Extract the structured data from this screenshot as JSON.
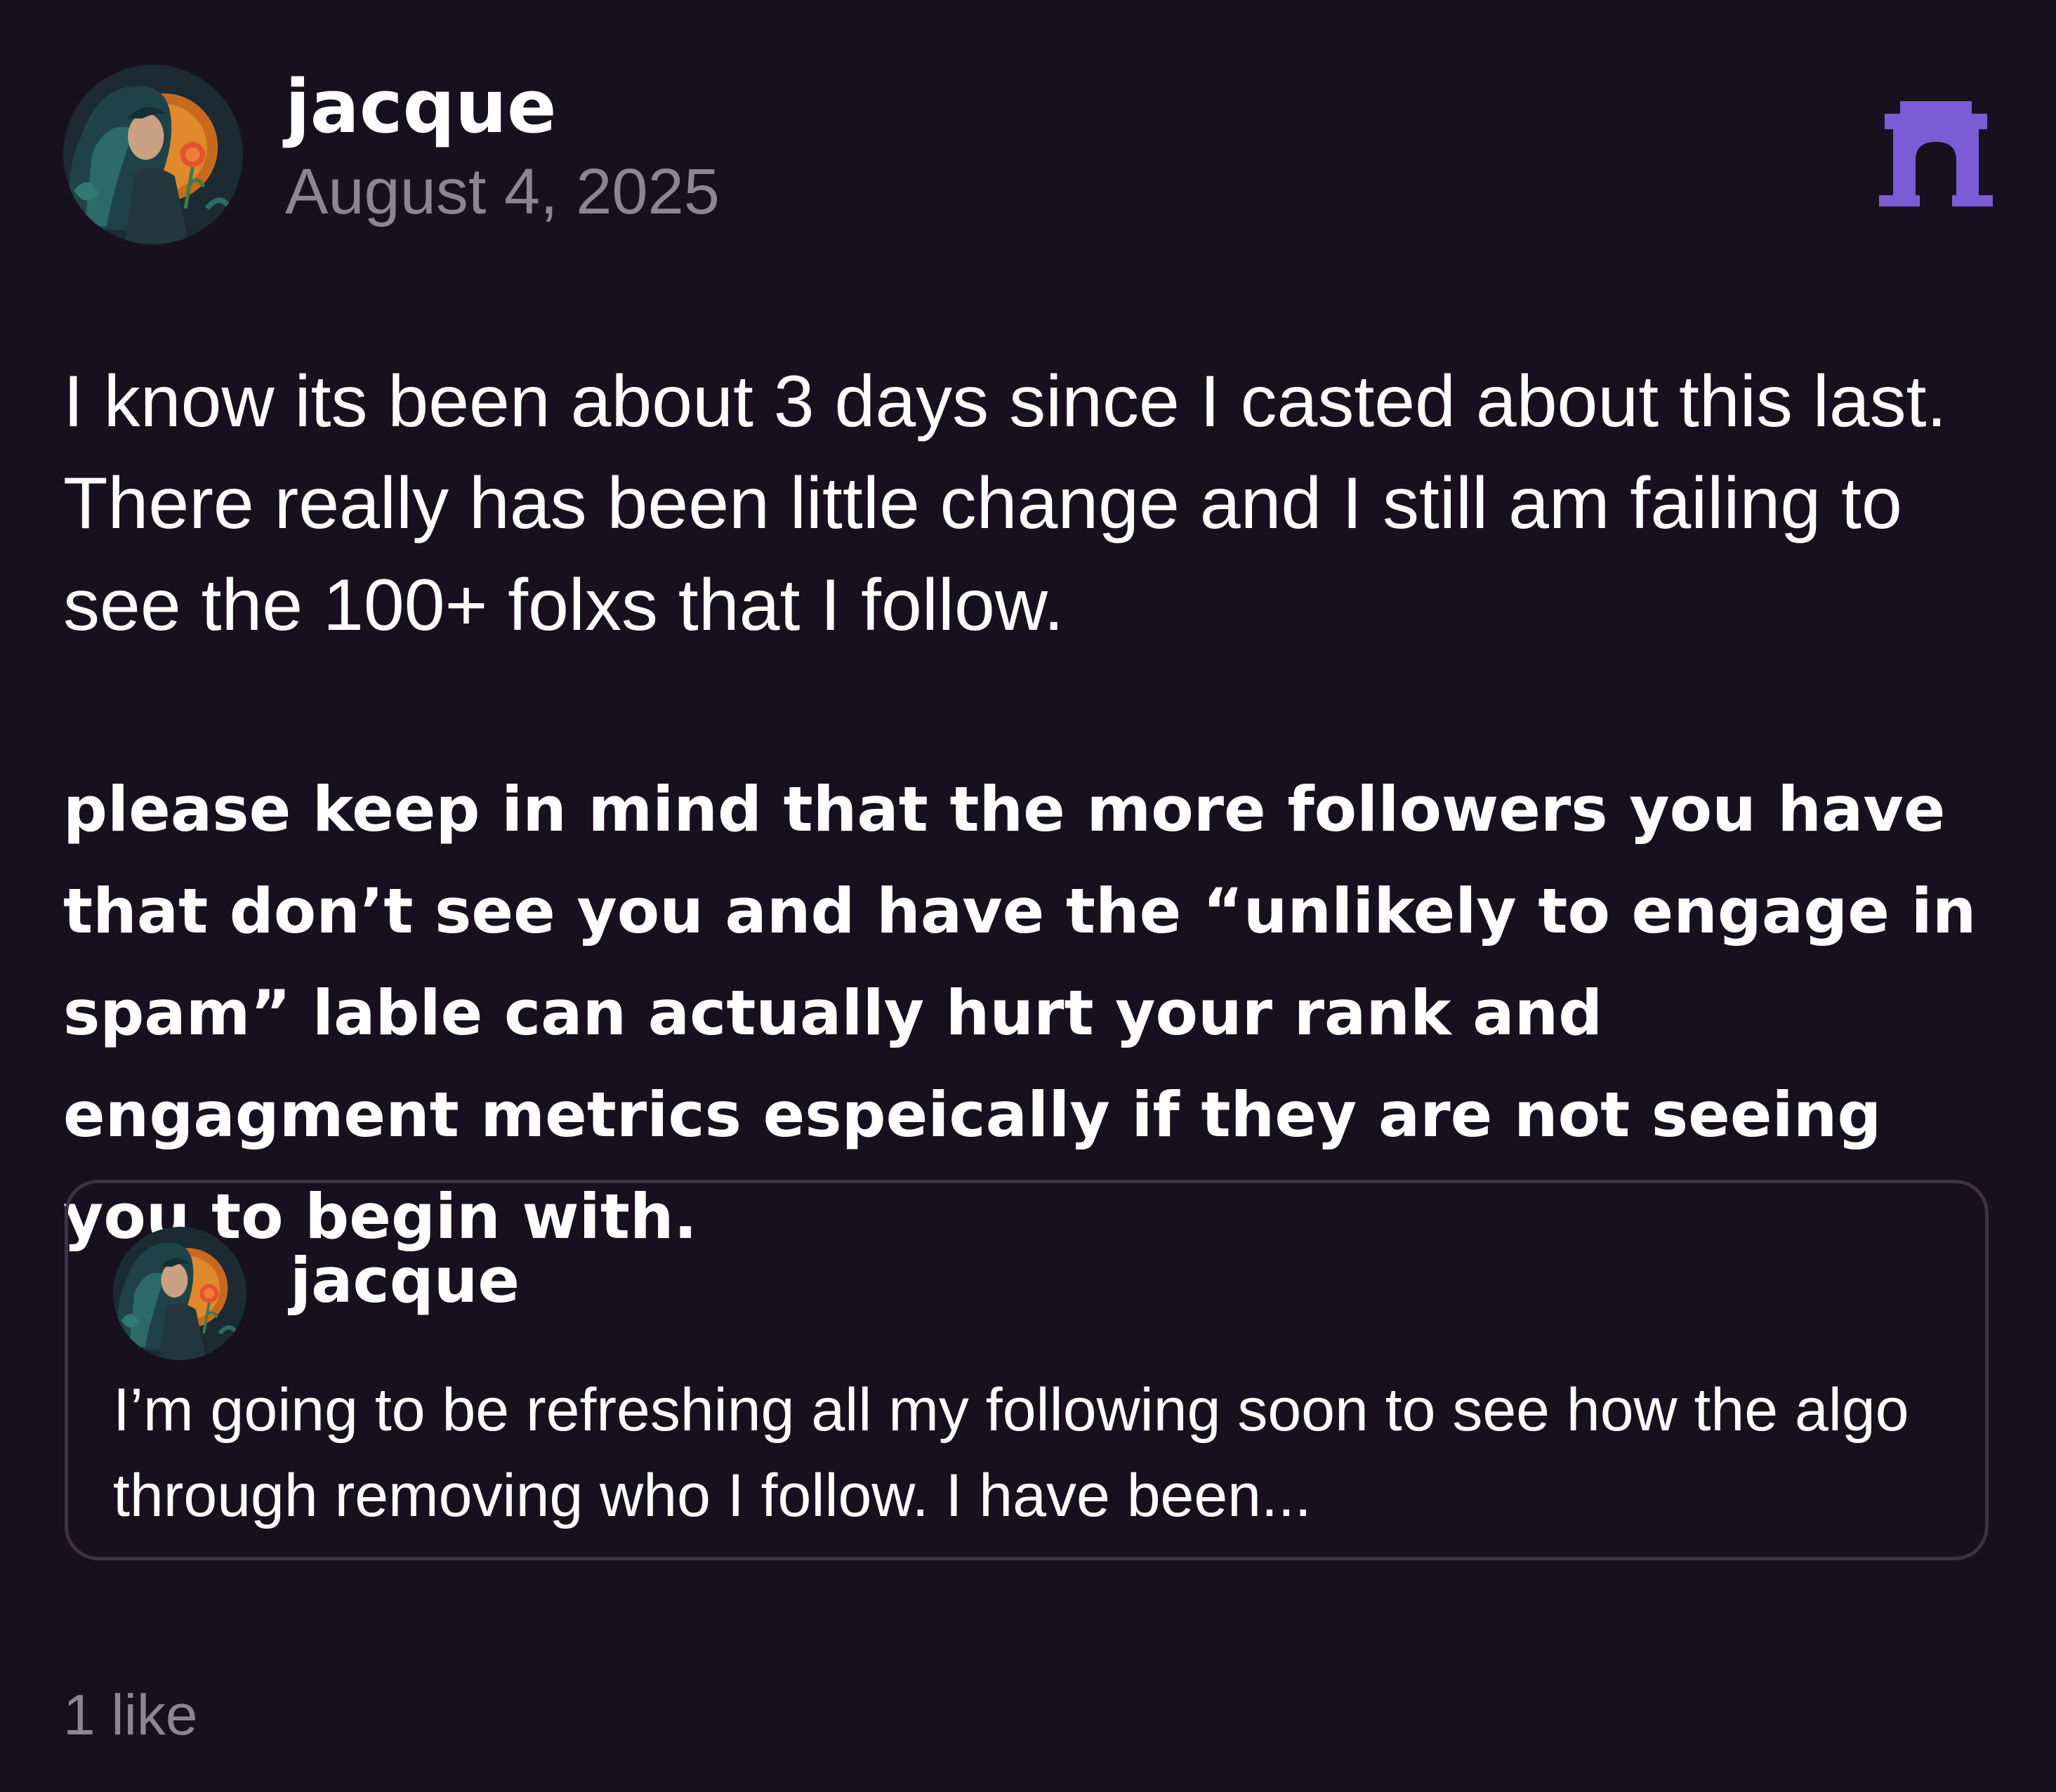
{
  "post": {
    "author": "jacque",
    "date": "August 4, 2025",
    "channel_icon": "arch-icon",
    "accent_color": "#7b5cd6",
    "paragraphs": [
      "I know its been about 3 days since I casted about this last. There really has been little change and I still am failing to see the 100+ folxs that I follow.",
      "please keep in mind that the more followers you have that don’t see you and have the “unlikely to engage in spam” lable can actually hurt your rank and engagment metrics espeically if they are not seeing you to begin with."
    ],
    "likes": "1 like"
  },
  "quote": {
    "author": "jacque",
    "text": "I’m going to be refreshing all my following soon to see how the algo through removing who I follow. I have been..."
  }
}
